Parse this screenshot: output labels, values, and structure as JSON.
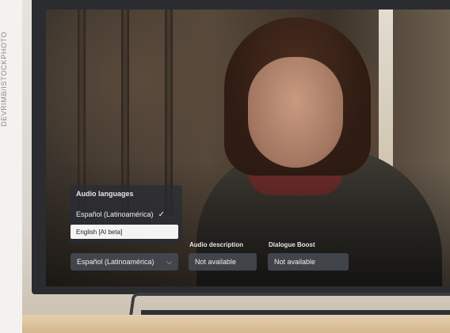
{
  "photo_credit": "DEVRIMB/ISTOCKPHOTO",
  "audio_menu": {
    "title": "Audio languages",
    "selected_option": "Español (Latinoamérica)",
    "highlighted_option": "English [AI beta]"
  },
  "controls": {
    "language_dropdown": {
      "value": "Español (Latinoamérica)"
    },
    "audio_description": {
      "label": "Audio description",
      "value": "Not available"
    },
    "dialogue_boost": {
      "label": "Dialogue Boost",
      "value": "Not available"
    }
  },
  "icons": {
    "selected": "check-icon",
    "dropdown": "chevron-down-icon"
  },
  "colors": {
    "highlight": "#f4f4f4",
    "panel": "#282c34"
  }
}
